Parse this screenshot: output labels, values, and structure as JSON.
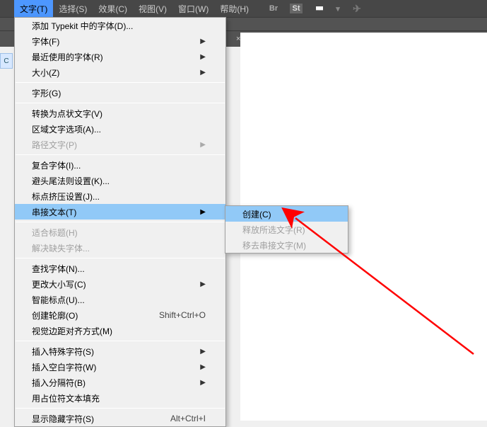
{
  "menubar": {
    "type": "文字(T)",
    "select": "选择(S)",
    "effect": "效果(C)",
    "view": "视图(V)",
    "window": "窗口(W)",
    "help": "帮助(H)"
  },
  "toolbar": {
    "br_icon": "Br",
    "st_icon": "St",
    "grid_icon": "■■",
    "paper_icon": "✈"
  },
  "tab": {
    "close": "×"
  },
  "gutter": {
    "label": "C"
  },
  "menu": {
    "typekit": "添加 Typekit 中的字体(D)...",
    "font": "字体(F)",
    "recent": "最近使用的字体(R)",
    "size": "大小(Z)",
    "glyph": "字形(G)",
    "convert_point": "转换为点状文字(V)",
    "area_options": "区域文字选项(A)...",
    "path_text": "路径文字(P)",
    "composite": "复合字体(I)...",
    "kinsoku": "避头尾法则设置(K)...",
    "mojikumi": "标点挤压设置(J)...",
    "thread": "串接文本(T)",
    "fit_headline": "适合标题(H)",
    "resolve_missing": "解决缺失字体...",
    "find_font": "查找字体(N)...",
    "change_case": "更改大小写(C)",
    "smart_punct": "智能标点(U)...",
    "create_outlines": "创建轮廓(O)",
    "create_outlines_sc": "Shift+Ctrl+O",
    "optical_margin": "视觉边距对齐方式(M)",
    "insert_special": "插入特殊字符(S)",
    "insert_whitespace": "插入空白字符(W)",
    "insert_break": "插入分隔符(B)",
    "placeholder": "用占位符文本填充",
    "show_hidden": "显示隐藏字符(S)",
    "show_hidden_sc": "Alt+Ctrl+I"
  },
  "submenu": {
    "create": "创建(C)",
    "release": "释放所选文字(R)",
    "remove": "移去串接文字(M)"
  }
}
